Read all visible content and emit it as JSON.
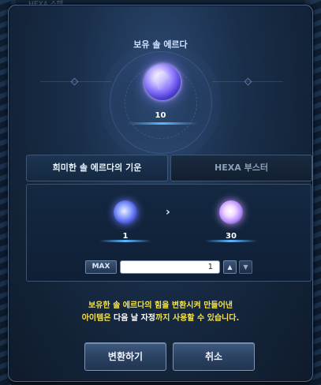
{
  "background": {
    "top_strip_text": "HEXA 스탯"
  },
  "header": {
    "title": "보유 솔 에르다",
    "owned_count": "10"
  },
  "tabs": [
    {
      "label": "희미한 솔 에르다의 기운",
      "active": true
    },
    {
      "label": "HEXA 부스터",
      "active": false
    }
  ],
  "conversion": {
    "source_count": "1",
    "result_count": "30",
    "arrow": "›",
    "max_label": "MAX",
    "quantity_value": "1",
    "step_up": "▲",
    "step_down": "▼"
  },
  "notice": {
    "line1": "보유한 솔 에르다의 힘을 변환시켜 만들어낸",
    "line2_part1": "아이템은 ",
    "line2_part2": "다음 날 자정",
    "line2_part3": "까지 사용할 수 있습니다."
  },
  "buttons": {
    "convert": "변환하기",
    "cancel": "취소"
  },
  "colors": {
    "accent_glow": "#5fb7ff",
    "notice_yellow": "#f5e24a",
    "panel_border": "#3a5270"
  }
}
